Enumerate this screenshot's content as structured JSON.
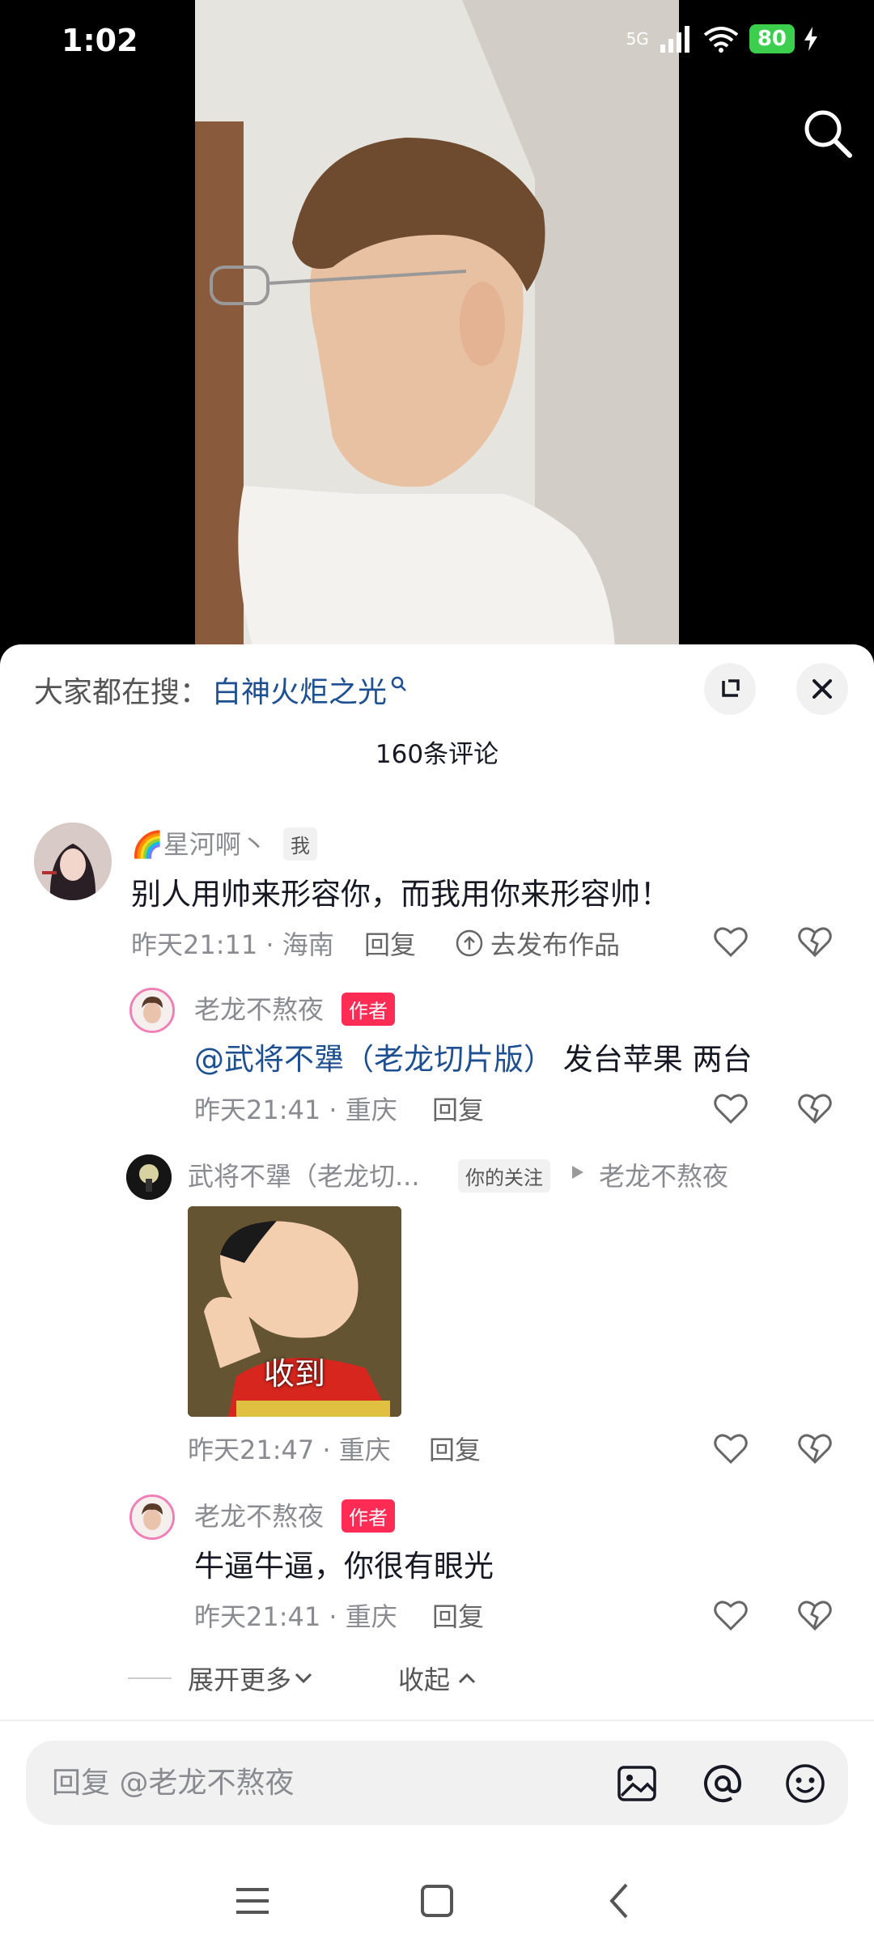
{
  "status_bar": {
    "time": "1:02",
    "network": "5G",
    "battery": "80"
  },
  "video": {
    "search_icon": "search-icon"
  },
  "header": {
    "hot_search_label": "大家都在搜：",
    "hot_search_term": "白神火炬之光",
    "comment_count": "160条评论"
  },
  "comments": {
    "c1": {
      "name": "🌈星河啊丶",
      "badge": "我",
      "text": "别人用帅来形容你，而我用你来形容帅！",
      "time_location": "昨天21:11 · 海南",
      "reply": "回复",
      "publish": "去发布作品"
    },
    "r1": {
      "name": "老龙不熬夜",
      "badge": "作者",
      "mention": "@武将不犟（老龙切片版）",
      "text": " 发台苹果 两台",
      "time_location": "昨天21:41 · 重庆",
      "reply": "回复"
    },
    "r2": {
      "name": "武将不犟（老龙切...",
      "badge": "你的关注",
      "reply_to": "老龙不熬夜",
      "sticker_text": "收到",
      "time_location": "昨天21:47 · 重庆",
      "reply": "回复"
    },
    "r3": {
      "name": "老龙不熬夜",
      "badge": "作者",
      "text": "牛逼牛逼，你很有眼光",
      "time_location": "昨天21:41 · 重庆",
      "reply": "回复"
    }
  },
  "thread_controls": {
    "expand_more": "展开更多",
    "collapse": "收起"
  },
  "reply_bar": {
    "placeholder": "回复 @老龙不熬夜"
  },
  "colors": {
    "accent_blue": "#1d4f91",
    "author_tag": "#fe2c55",
    "battery_green": "#3ccf4e"
  }
}
